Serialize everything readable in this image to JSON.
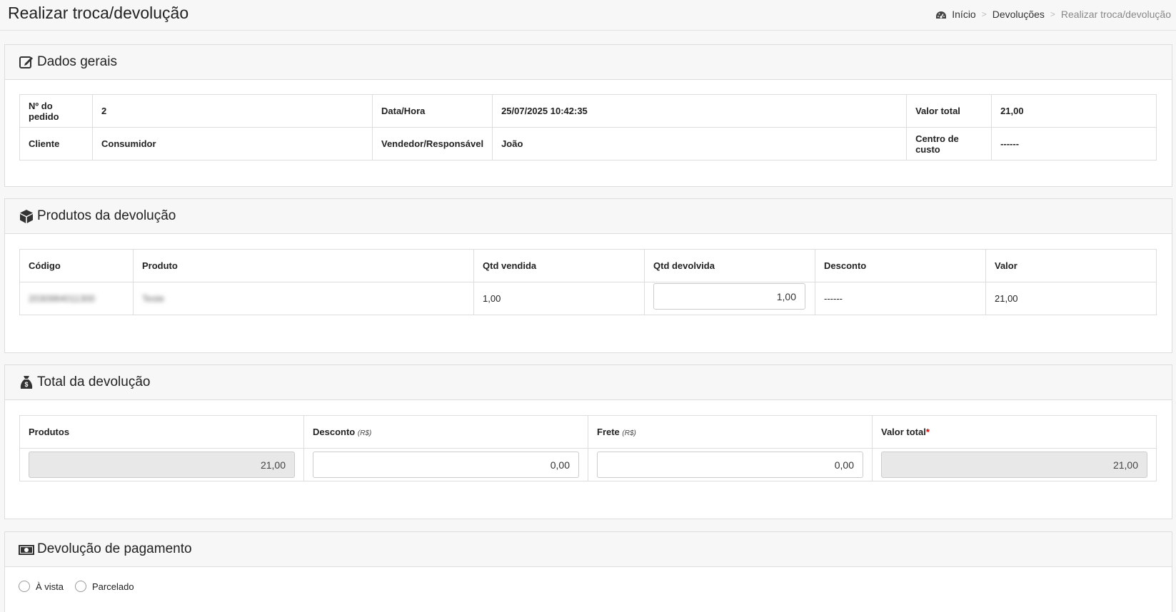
{
  "header": {
    "title": "Realizar troca/devolução",
    "breadcrumb": [
      "Início",
      "Devoluções",
      "Realizar troca/devolução"
    ]
  },
  "dados_gerais": {
    "title": "Dados gerais",
    "rows": [
      [
        {
          "label": "Nº do pedido",
          "value": "2"
        },
        {
          "label": "Data/Hora",
          "value": "25/07/2025 10:42:35"
        },
        {
          "label": "Valor total",
          "value": "21,00"
        }
      ],
      [
        {
          "label": "Cliente",
          "value": "Consumidor"
        },
        {
          "label": "Vendedor/Responsável",
          "value": "João"
        },
        {
          "label": "Centro de custo",
          "value": "------"
        }
      ]
    ]
  },
  "produtos": {
    "title": "Produtos da devolução",
    "columns": [
      "Código",
      "Produto",
      "Qtd vendida",
      "Qtd devolvida",
      "Desconto",
      "Valor"
    ],
    "items": [
      {
        "codigo": "2030984011300",
        "produto": "Teste",
        "qtd_vendida": "1,00",
        "qtd_devolvida": "1,00",
        "desconto": "------",
        "valor": "21,00"
      }
    ]
  },
  "total": {
    "title": "Total da devolução",
    "columns": [
      {
        "label": "Produtos",
        "unit": ""
      },
      {
        "label": "Desconto",
        "unit": "(R$)"
      },
      {
        "label": "Frete",
        "unit": "(R$)"
      },
      {
        "label": "Valor total",
        "unit": ""
      }
    ],
    "required_mark": "*",
    "values": {
      "produtos": "21,00",
      "desconto": "0,00",
      "frete": "0,00",
      "valor_total": "21,00"
    }
  },
  "pagamento": {
    "title": "Devolução de pagamento",
    "options": [
      "À vista",
      "Parcelado"
    ]
  },
  "colors": {
    "accent": "#222222",
    "required": "#cc0000",
    "border": "#dddddd"
  }
}
